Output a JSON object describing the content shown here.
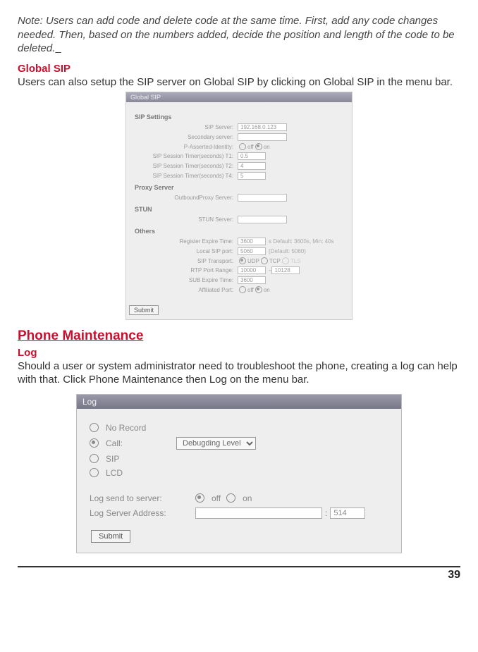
{
  "note": "Note: Users can add code and delete code at the same time.   First, add any code changes needed.  Then, based on the numbers added, decide the position and length of the code to be deleted.",
  "globalSip": {
    "heading": "Global SIP",
    "intro": "Users can also setup the SIP server on Global SIP by clicking on Global SIP in the menu bar.",
    "panel": {
      "title": "Global SIP",
      "groups": {
        "sipSettings": "SIP Settings",
        "proxy": "Proxy Server",
        "stun": "STUN",
        "others": "Others"
      },
      "labels": {
        "sipServer": "SIP Server:",
        "secondary": "Secondary server:",
        "pAsserted": "P-Asserted-Identity:",
        "t1": "SIP Session Timer(seconds) T1:",
        "t2": "SIP Session Timer(seconds) T2:",
        "t4": "SIP Session Timer(seconds) T4:",
        "outbound": "OutboundProxy Server:",
        "stunServer": "STUN Server:",
        "registerExpire": "Register Expire Time:",
        "localSipPort": "Local SIP port:",
        "sipTransport": "SIP Transport:",
        "rtpRange": "RTP Port Range:",
        "subExpire": "SUB Expire Time:",
        "affiliatedPort": "Affiliated Port:"
      },
      "values": {
        "sipServer": "192.168.0.123",
        "t1": "0.5",
        "t2": "4",
        "t4": "5",
        "registerExpire": "3600",
        "registerHint": "s Default: 3600s, Min: 40s",
        "localSipPort": "5060",
        "localSipPortHint": "(Default: 5060)",
        "rtp1": "10000",
        "rtp2": "10128",
        "subExpire": "3600"
      },
      "radio": {
        "off": "off",
        "on": "on",
        "udp": "UDP",
        "tcp": "TCP",
        "tls": "TLS"
      },
      "submit": "Submit"
    }
  },
  "phoneMaintenance": {
    "title": "Phone Maintenance",
    "log": {
      "heading": "Log",
      "intro": "Should a user or system administrator need to troubleshoot the phone, creating a log can help with that.  Click Phone Maintenance then Log on the menu bar.",
      "panel": {
        "title": "Log",
        "options": {
          "noRecord": "No Record",
          "call": "Call:",
          "sip": "SIP",
          "lcd": "LCD"
        },
        "levelSelect": "Debugding Level",
        "labels": {
          "sendToServer": "Log send to server:",
          "serverAddress": "Log Server Address:"
        },
        "radio": {
          "off": "off",
          "on": "on"
        },
        "portValue": "514",
        "submit": "Submit"
      }
    }
  },
  "pageNumber": "39"
}
